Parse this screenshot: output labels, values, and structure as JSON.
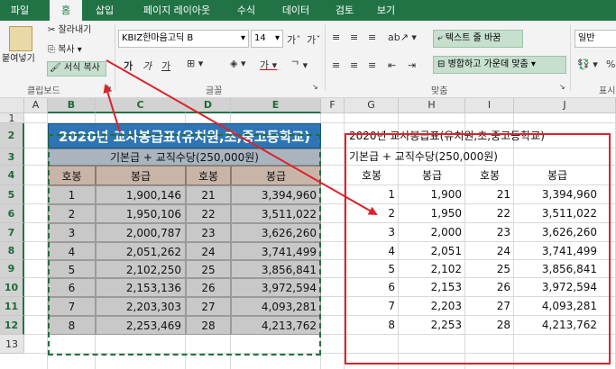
{
  "tabs": [
    "파일",
    "홈",
    "삽입",
    "페이지 레이아웃",
    "수식",
    "데이터",
    "검토",
    "보기"
  ],
  "ribbon": {
    "paste": "붙여넣기",
    "cut": "잘라내기",
    "copy": "복사",
    "format_painter": "서식 복사",
    "clipboard_group": "클립보드",
    "font_name": "KBIZ한마음고딕 B",
    "font_size": "14",
    "font_group": "글꼴",
    "wrap_text": "텍스트 줄 바꿈",
    "merge_center": "병합하고 가운데 맞춤",
    "alignment_group": "맞춤",
    "number_format": "일반",
    "number_group_partial": "표시"
  },
  "columns": [
    "A",
    "B",
    "C",
    "D",
    "E",
    "F",
    "G",
    "H",
    "I",
    "J"
  ],
  "rows": [
    "1",
    "2",
    "3",
    "4",
    "5",
    "6",
    "7",
    "8",
    "9",
    "10",
    "11",
    "12",
    "13"
  ],
  "table": {
    "title": "2020년 교사봉급표(유치원,초,중고등학교)",
    "subtitle": "기본급 + 교직수당(250,000원)",
    "headers": [
      "호봉",
      "봉급",
      "호봉",
      "봉급"
    ],
    "rows": [
      [
        "1",
        "1,900,146",
        "21",
        "3,394,960"
      ],
      [
        "2",
        "1,950,106",
        "22",
        "3,511,022"
      ],
      [
        "3",
        "2,000,787",
        "23",
        "3,626,260"
      ],
      [
        "4",
        "2,051,262",
        "24",
        "3,741,499"
      ],
      [
        "5",
        "2,102,250",
        "25",
        "3,856,841"
      ],
      [
        "6",
        "2,153,136",
        "26",
        "3,972,594"
      ],
      [
        "7",
        "2,203,303",
        "27",
        "4,093,281"
      ],
      [
        "8",
        "2,253,469",
        "28",
        "4,213,762"
      ]
    ]
  },
  "copy_table": {
    "title": "2020년 교사봉급표(유치원,초,중고등학교)",
    "subtitle": "기본급 + 교직수당(250,000원)",
    "headers": [
      "호봉",
      "봉급",
      "호봉",
      "봉급"
    ],
    "rows": [
      [
        "1",
        "1,900",
        "21",
        "3,394,960"
      ],
      [
        "2",
        "1,950",
        "22",
        "3,511,022"
      ],
      [
        "3",
        "2,000",
        "23",
        "3,626,260"
      ],
      [
        "4",
        "2,051",
        "24",
        "3,741,499"
      ],
      [
        "5",
        "2,102",
        "25",
        "3,856,841"
      ],
      [
        "6",
        "2,153",
        "26",
        "3,972,594"
      ],
      [
        "7",
        "2,203",
        "27",
        "4,093,281"
      ],
      [
        "8",
        "2,253",
        "28",
        "4,213,762"
      ]
    ]
  },
  "colors": {
    "brand": "#217346",
    "title_fill": "#2e75b6",
    "subtitle_fill": "#a9b4be",
    "header_fill": "#c9b5a8",
    "data_fill": "#c8c8c8",
    "annotation": "#e0202a"
  }
}
